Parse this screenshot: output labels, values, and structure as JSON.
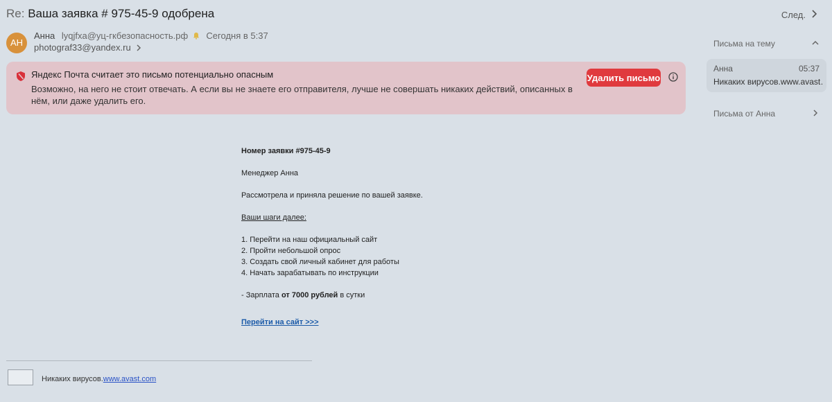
{
  "header": {
    "subject_prefix": "Re:",
    "subject": "Ваша заявка # 975-45-9 одобрена",
    "next_label": "След."
  },
  "sender": {
    "avatar_initials": "АН",
    "avatar_color": "#d8913b",
    "name": "Анна",
    "email": "lyqjfxa@уц-гкбезопасность.рф",
    "time": "Сегодня в 5:37",
    "recipient": "photograf33@yandex.ru"
  },
  "warning": {
    "title": "Яндекс Почта считает это письмо потенциально опасным",
    "text": "Возможно, на него не стоит отвечать. А если вы не знаете его отправителя, лучше не совершать никаких действий, описанных в нём, или даже удалить его.",
    "delete_label": "Удалить письмо",
    "banner_color": "#e2c4ca",
    "button_color": "#e03a3e"
  },
  "body": {
    "ticket": "Номер заявки #975-45-9",
    "manager": "Менеджер Анна",
    "decision": "Рассмотрела и приняла решение по вашей заявке.",
    "steps_title": "Ваши шаги далее:",
    "steps": [
      "1. Перейти на наш официальный сайт",
      "2. Пройти небольшой опрос",
      "3. Создать свой личный кабинет для работы",
      "4. Начать зарабатывать по инструкции"
    ],
    "salary_prefix": "- Зарплата ",
    "salary_bold": "от 7000 рублей",
    "salary_suffix": " в сутки",
    "link_label": "Перейти на сайт >>>"
  },
  "footer": {
    "text": "Никаких вирусов.",
    "link": "www.avast.com"
  },
  "sidebar": {
    "thread_title": "Письма на тему",
    "thread_item": {
      "name": "Анна",
      "time": "05:37",
      "snippet": "Никаких вирусов.www.avast…"
    },
    "from_title": "Письма от Анна"
  }
}
